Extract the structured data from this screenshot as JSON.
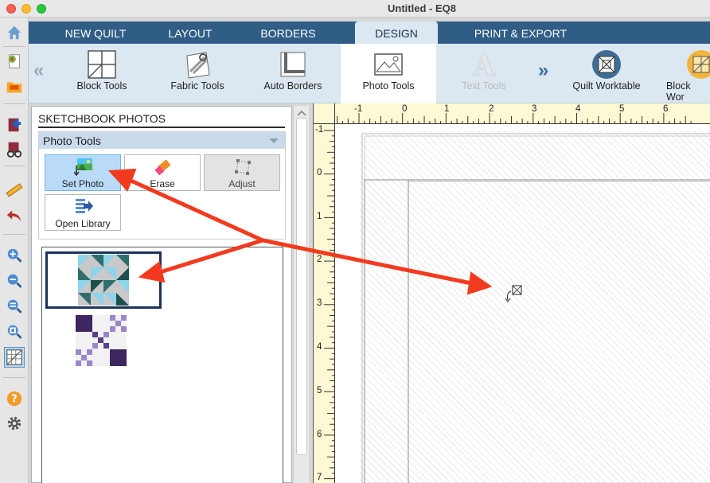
{
  "window": {
    "title": "Untitled - EQ8"
  },
  "tabs": [
    {
      "label": "NEW QUILT",
      "active": false
    },
    {
      "label": "LAYOUT",
      "active": false
    },
    {
      "label": "BORDERS",
      "active": false
    },
    {
      "label": "DESIGN",
      "active": true
    },
    {
      "label": "PRINT & EXPORT",
      "active": false
    }
  ],
  "ribbon": {
    "items": [
      {
        "label": "Block Tools",
        "icon": "block-tools-icon",
        "state": "normal"
      },
      {
        "label": "Fabric Tools",
        "icon": "fabric-tools-icon",
        "state": "normal"
      },
      {
        "label": "Auto Borders",
        "icon": "auto-borders-icon",
        "state": "normal"
      },
      {
        "label": "Photo Tools",
        "icon": "photo-tools-icon",
        "state": "active"
      },
      {
        "label": "Text Tools",
        "icon": "text-tools-icon",
        "state": "disabled"
      },
      {
        "label": "Quilt Worktable",
        "icon": "quilt-worktable-icon",
        "state": "normal"
      },
      {
        "label": "Block Wor",
        "icon": "block-worktable-icon",
        "state": "normal"
      }
    ]
  },
  "left_toolbar": [
    "new-quilt-icon",
    "open-file-icon",
    "add-to-sketchbook-icon",
    "view-sketchbook-icon",
    "ruler-icon",
    "undo-icon",
    "zoom-in-icon",
    "zoom-out-icon",
    "zoom-fit-icon",
    "zoom-page-icon",
    "grid-view-icon",
    "help-icon",
    "settings-icon"
  ],
  "panel": {
    "title": "SKETCHBOOK PHOTOS",
    "section_title": "Photo Tools",
    "buttons": [
      {
        "label": "Set Photo",
        "icon": "set-photo-icon",
        "state": "selected"
      },
      {
        "label": "Erase",
        "icon": "erase-icon",
        "state": "normal"
      },
      {
        "label": "Adjust",
        "icon": "adjust-icon",
        "state": "disabled"
      },
      {
        "label": "Open Library",
        "icon": "open-library-icon",
        "state": "normal"
      }
    ],
    "photos": [
      {
        "name": "star-block-photo",
        "selected": true
      },
      {
        "name": "nine-patch-block-photo",
        "selected": false
      }
    ]
  },
  "ruler": {
    "top_labels": [
      "-1",
      "0",
      "1",
      "2",
      "3",
      "4",
      "5",
      "6"
    ],
    "left_labels": [
      "-1",
      "0",
      "1",
      "2",
      "3",
      "4",
      "5",
      "6",
      "7"
    ]
  },
  "colors": {
    "tab_bar": "#2f5d86",
    "ribbon": "#dce8f1",
    "selected_button": "#b9dbf7",
    "annotation_arrow": "#f23a1e",
    "ruler": "#fdf9d4"
  }
}
